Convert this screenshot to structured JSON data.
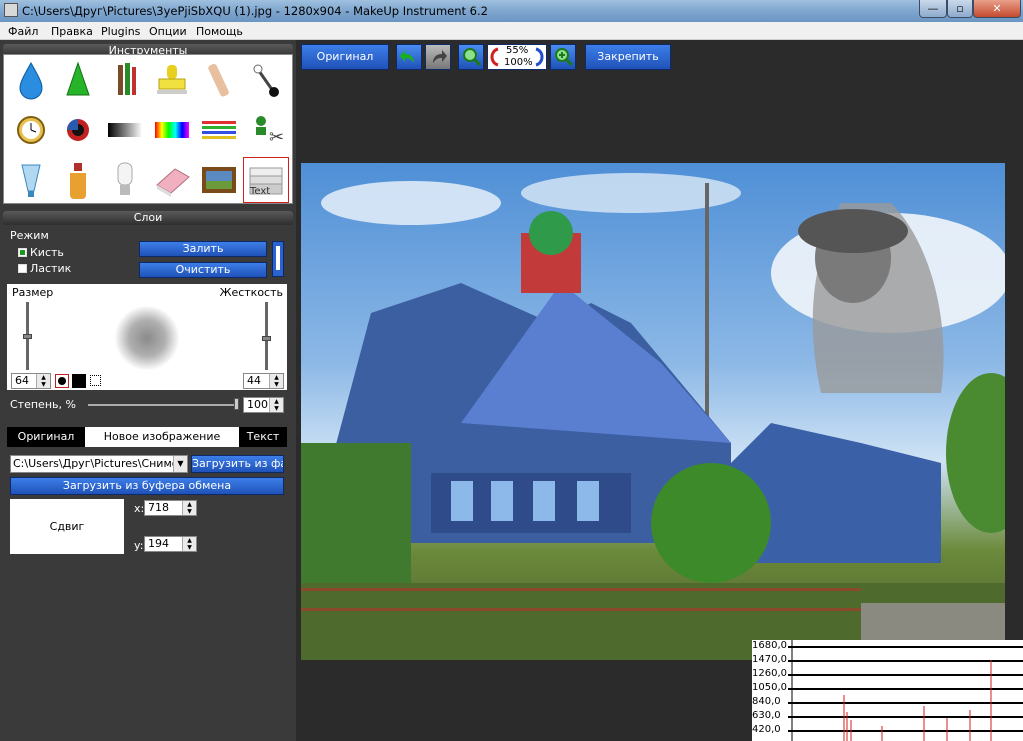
{
  "window": {
    "title": "C:\\Users\\Друг\\Pictures\\3yePjiSbXQU (1).jpg - 1280x904 - MakeUp Instrument 6.2",
    "min": "—",
    "max": "▫",
    "close": "✕"
  },
  "menu": [
    "Файл",
    "Правка",
    "Plugins",
    "Опции",
    "Помощь"
  ],
  "tools_panel": {
    "title": "Инструменты",
    "selected": "text-tool",
    "selected_label": "Text"
  },
  "layers_panel": {
    "title": "Слои",
    "mode_label": "Режим",
    "brush_label": "Кисть",
    "eraser_label": "Ластик",
    "fill_button": "Залить",
    "clear_button": "Очистить",
    "size_label": "Размер",
    "hardness_label": "Жесткость",
    "size_value": "64",
    "hardness_value": "44",
    "degree_label": "Степень, %",
    "degree_value": "100",
    "tabs": [
      "Оригинал",
      "Новое изображение",
      "Текст"
    ],
    "active_tab": 1,
    "path_value": "C:\\Users\\Друг\\Pictures\\Снимок",
    "load_file_button": "Загрузить из файл",
    "load_clipboard_button": "Загрузить из буфера обмена",
    "shift_label": "Сдвиг",
    "x_label": "x:",
    "x_value": "718",
    "y_label": "y:",
    "y_value": "194"
  },
  "toolbar": {
    "original_button": "Оригинал",
    "zoom_top": "55%",
    "zoom_bottom": "100%",
    "pin_button": "Закрепить"
  },
  "histogram": {
    "y_labels": [
      "1680,0",
      "1470,0",
      "1260,0",
      "1050,0",
      "840,0",
      "630,0",
      "420,0"
    ]
  },
  "colors": {
    "accent": "#2a62d0",
    "panel": "#3a3a3a",
    "workspace": "#2b2b2b"
  }
}
